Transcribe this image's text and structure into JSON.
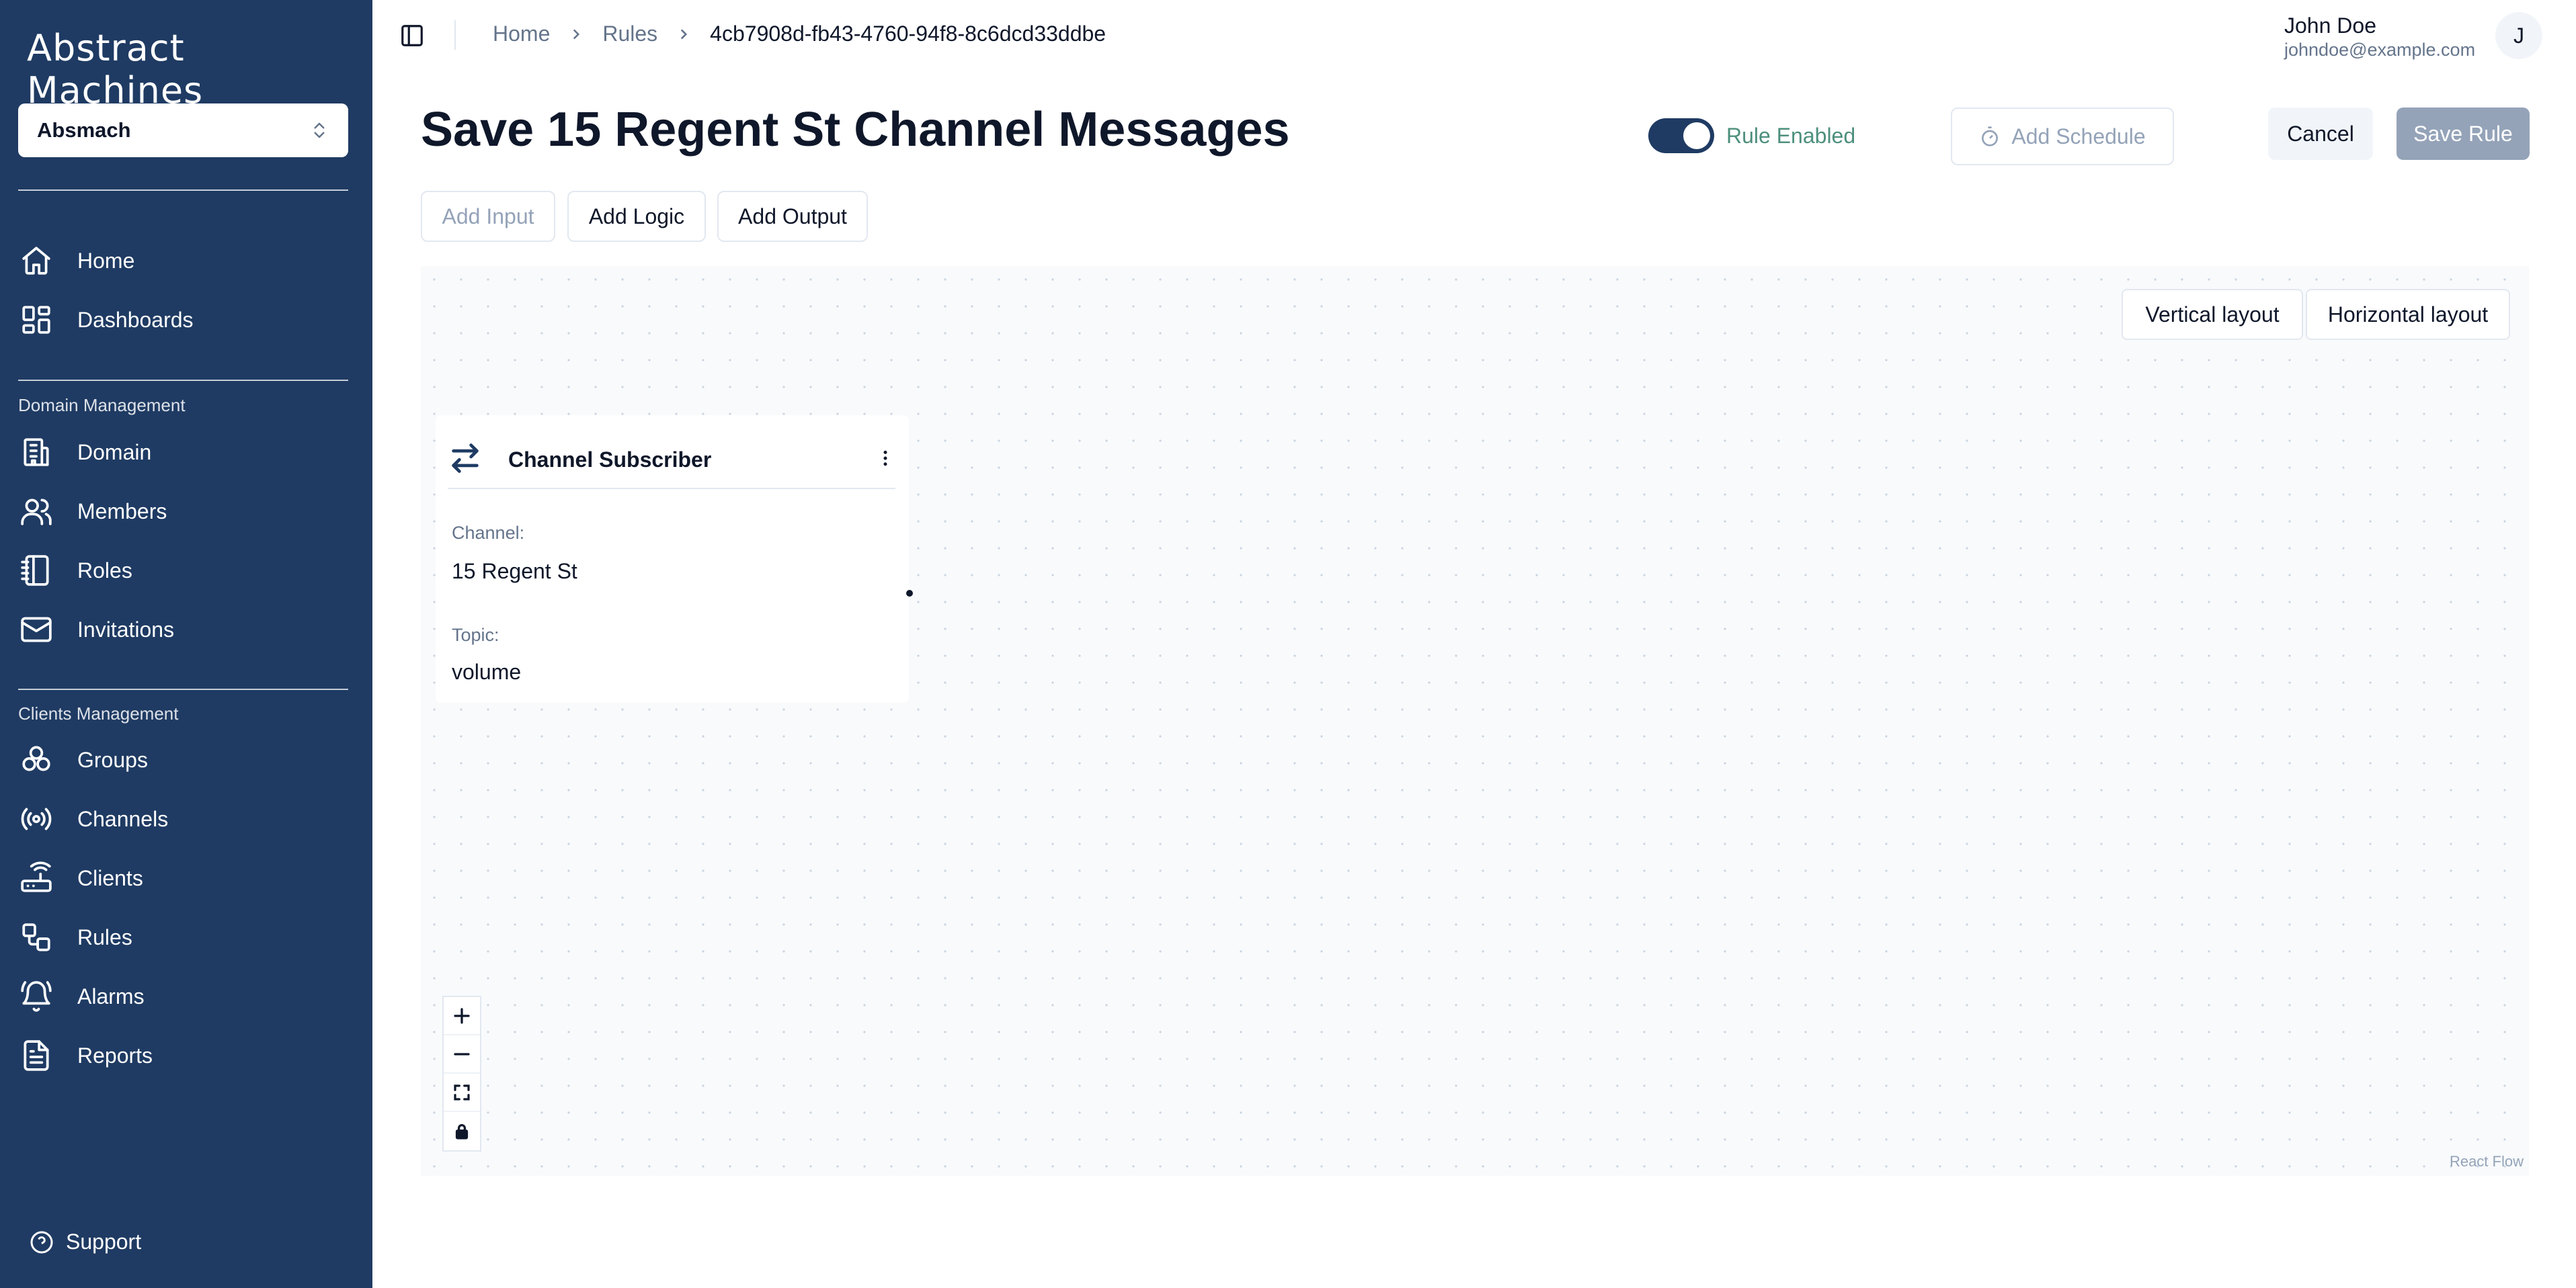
{
  "brand": {
    "name": "Abstract Machines"
  },
  "org_selector": {
    "value": "Absmach"
  },
  "sidebar": {
    "main_items": [
      {
        "label": "Home",
        "icon": "home-icon"
      },
      {
        "label": "Dashboards",
        "icon": "dashboard-icon"
      }
    ],
    "domain_section": {
      "label": "Domain Management",
      "items": [
        {
          "label": "Domain",
          "icon": "building-icon"
        },
        {
          "label": "Members",
          "icon": "users-icon"
        },
        {
          "label": "Roles",
          "icon": "notebook-icon"
        },
        {
          "label": "Invitations",
          "icon": "mail-icon"
        }
      ]
    },
    "clients_section": {
      "label": "Clients Management",
      "items": [
        {
          "label": "Groups",
          "icon": "groups-icon"
        },
        {
          "label": "Channels",
          "icon": "radio-icon"
        },
        {
          "label": "Clients",
          "icon": "router-icon"
        },
        {
          "label": "Rules",
          "icon": "workflow-icon"
        },
        {
          "label": "Alarms",
          "icon": "bell-icon"
        },
        {
          "label": "Reports",
          "icon": "report-icon"
        }
      ]
    },
    "support_label": "Support"
  },
  "breadcrumb": {
    "items": [
      "Home",
      "Rules"
    ],
    "current": "4cb7908d-fb43-4760-94f8-8c6dcd33ddbe"
  },
  "user": {
    "name": "John Doe",
    "email": "johndoe@example.com",
    "initial": "J"
  },
  "header": {
    "title": "Save 15 Regent St Channel Messages",
    "toggle_label": "Rule Enabled",
    "toggle_on": true,
    "schedule_label": "Add Schedule",
    "cancel_label": "Cancel",
    "save_label": "Save Rule"
  },
  "toolbar": {
    "add_input": "Add Input",
    "add_logic": "Add Logic",
    "add_output": "Add Output"
  },
  "canvas": {
    "vertical_layout": "Vertical layout",
    "horizontal_layout": "Horizontal layout",
    "attribution": "React Flow",
    "node": {
      "title": "Channel Subscriber",
      "channel_label": "Channel:",
      "channel_value": "15 Regent St",
      "topic_label": "Topic:",
      "topic_value": "volume"
    }
  },
  "colors": {
    "sidebar_bg": "#1f3b63",
    "toggle_on": "#1f3b63",
    "toggle_label": "#4d8f7d",
    "save_disabled": "#94a3b8"
  }
}
